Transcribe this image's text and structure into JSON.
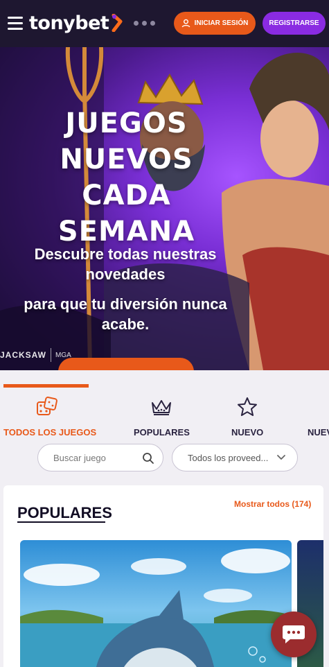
{
  "header": {
    "logo_text": "tonybet",
    "login_label": "INICIAR SESIÓN",
    "register_label": "REGISTRARSE"
  },
  "banner": {
    "title_lines": [
      "JUEGOS",
      "NUEVOS",
      "CADA",
      "SEMANA"
    ],
    "subtitle_1": "Descubre todas nuestras novedades",
    "subtitle_2": "para que tu diversión nunca acabe.",
    "provider_1": "JACKSAW",
    "provider_2": "MGA"
  },
  "tabs": [
    {
      "label": "TODOS LOS JUEGOS",
      "icon": "dice-icon",
      "active": true
    },
    {
      "label": "POPULARES",
      "icon": "crown-icon",
      "active": false
    },
    {
      "label": "NUEVO",
      "icon": "star-icon",
      "active": false
    },
    {
      "label": "NUEVO",
      "icon": "star-icon",
      "active": false
    }
  ],
  "filters": {
    "search_placeholder": "Buscar juego",
    "provider_selected": "Todos los proveed..."
  },
  "section": {
    "title": "POPULARES",
    "show_all": "Mostrar todos (174)"
  },
  "colors": {
    "accent_orange": "#e8591a",
    "accent_purple": "#8a2be2",
    "header_bg": "#1e1730",
    "chat_bg": "#9b2c2e"
  }
}
